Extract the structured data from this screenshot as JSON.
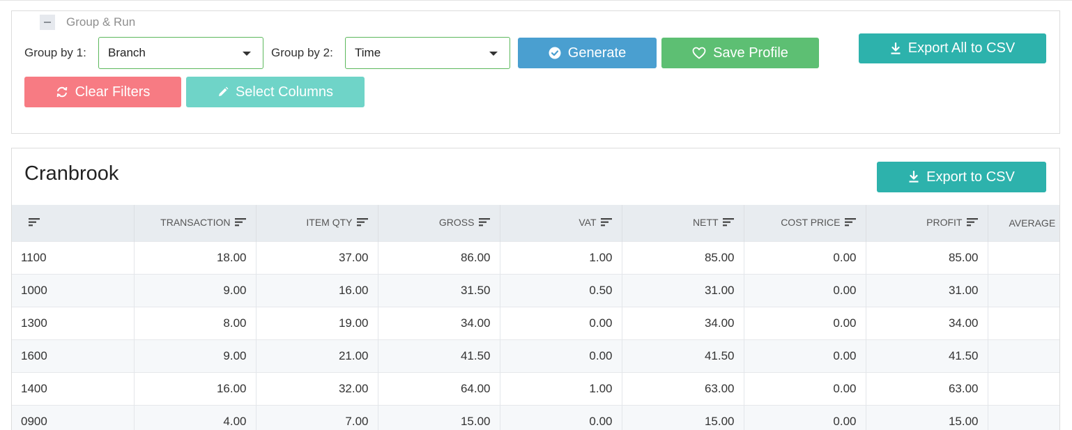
{
  "group_run": {
    "legend": "Group & Run",
    "group_by_1_label": "Group by 1:",
    "group_by_1_value": "Branch",
    "group_by_2_label": "Group by 2:",
    "group_by_2_value": "Time",
    "generate_label": "Generate",
    "save_profile_label": "Save Profile",
    "export_all_label": "Export All to CSV",
    "clear_filters_label": "Clear Filters",
    "select_columns_label": "Select Columns"
  },
  "report": {
    "title": "Cranbrook",
    "export_label": "Export to CSV",
    "columns": [
      "",
      "TRANSACTION",
      "ITEM QTY",
      "GROSS",
      "VAT",
      "NETT",
      "COST PRICE",
      "PROFIT",
      "AVERAGE"
    ],
    "rows": [
      [
        "1100",
        "18.00",
        "37.00",
        "86.00",
        "1.00",
        "85.00",
        "0.00",
        "85.00",
        ""
      ],
      [
        "1000",
        "9.00",
        "16.00",
        "31.50",
        "0.50",
        "31.00",
        "0.00",
        "31.00",
        ""
      ],
      [
        "1300",
        "8.00",
        "19.00",
        "34.00",
        "0.00",
        "34.00",
        "0.00",
        "34.00",
        ""
      ],
      [
        "1600",
        "9.00",
        "21.00",
        "41.50",
        "0.00",
        "41.50",
        "0.00",
        "41.50",
        ""
      ],
      [
        "1400",
        "16.00",
        "32.00",
        "64.00",
        "1.00",
        "63.00",
        "0.00",
        "63.00",
        ""
      ],
      [
        "0900",
        "4.00",
        "7.00",
        "15.00",
        "0.00",
        "15.00",
        "0.00",
        "15.00",
        ""
      ]
    ]
  },
  "icons": {
    "collapse": "minus-icon",
    "generate": "check-circle-icon",
    "save": "heart-icon",
    "export": "download-icon",
    "clear": "refresh-icon",
    "columns": "pencil-icon",
    "sort": "sort-icon"
  },
  "colors": {
    "generate": "#4a9fd0",
    "save": "#5dbf73",
    "export": "#2db2ac",
    "clear": "#f77b83",
    "columns": "#6fd4c8",
    "select_border": "#5cb85c"
  }
}
